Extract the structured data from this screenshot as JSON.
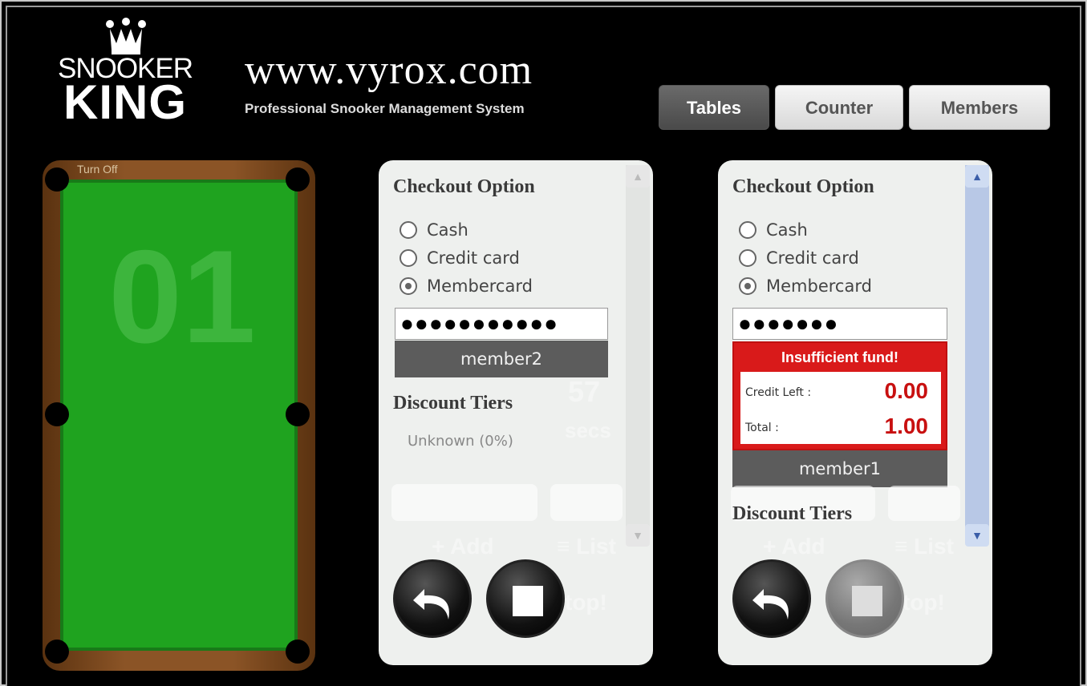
{
  "header": {
    "logo_top": "SNOOKER",
    "logo_bottom": "KING",
    "site_url": "www.vyrox.com",
    "site_subtitle": "Professional Snooker Management System"
  },
  "nav": {
    "tables": "Tables",
    "counter": "Counter",
    "members": "Members",
    "active": "Tables"
  },
  "table": {
    "number": "01",
    "turn_off": "Turn Off"
  },
  "panel1": {
    "title": "Checkout Option",
    "options": [
      "Cash",
      "Credit card",
      "Membercard"
    ],
    "selected": "Membercard",
    "password_mask": "●●●●●●●●●●●",
    "member": "member2",
    "discount_title": "Discount Tiers",
    "discount_value": "Unknown (0%)",
    "ghost_secs_value": "57",
    "ghost_secs_label": "secs",
    "ghost_add": "+ Add",
    "ghost_list": "≡ List",
    "ghost_stop": "top!"
  },
  "panel2": {
    "title": "Checkout Option",
    "options": [
      "Cash",
      "Credit card",
      "Membercard"
    ],
    "selected": "Membercard",
    "password_mask": "●●●●●●●",
    "alert_title": "Insufficient fund!",
    "credit_left_label": "Credit Left :",
    "credit_left_value": "0.00",
    "total_label": "Total :",
    "total_value": "1.00",
    "member": "member1",
    "discount_title": "Discount Tiers",
    "ghost_add": "+ Add",
    "ghost_list": "≡ List",
    "ghost_stop": "top!"
  },
  "colors": {
    "felt": "#1fa31f",
    "alert": "#d91a1a",
    "alert_value": "#c81010"
  }
}
